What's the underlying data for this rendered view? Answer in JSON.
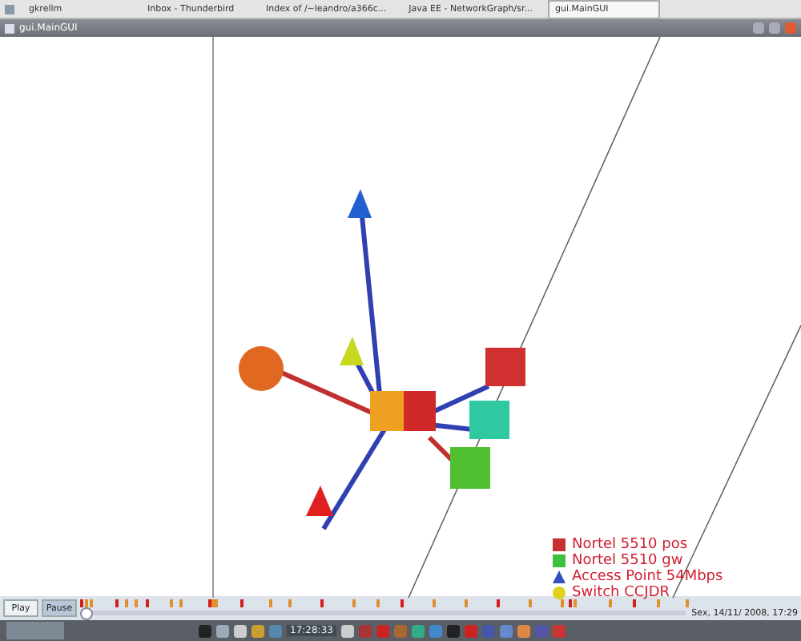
{
  "taskbar": {
    "tasks": [
      {
        "label": "gkrellm",
        "selected": false
      },
      {
        "label": "Inbox - Thunderbird",
        "selected": false
      },
      {
        "label": "Index of /~leandro/a366c...",
        "selected": false
      },
      {
        "label": "Java EE - NetworkGraph/sr...",
        "selected": false
      },
      {
        "label": "gui.MainGUI",
        "selected": true
      }
    ]
  },
  "window": {
    "title": "gui.MainGUI"
  },
  "legend": [
    {
      "kind": "square",
      "color": "#c83030",
      "label": "Nortel 5510 pos"
    },
    {
      "kind": "square",
      "color": "#40c040",
      "label": "Nortel 5510 gw"
    },
    {
      "kind": "cone",
      "color": "#3050c0",
      "label": "Access Point 54Mbps"
    },
    {
      "kind": "sphere",
      "color": "#e0d020",
      "label": "Switch CCJDR"
    }
  ],
  "controls": {
    "buttons": [
      {
        "label": "Play",
        "selected": false
      },
      {
        "label": "Pause",
        "selected": true
      }
    ],
    "slider": {
      "level": 0.0
    },
    "date": "Sex, 14/11/ 2008, 17:29"
  },
  "dock": {
    "clock": "17:28:33"
  }
}
